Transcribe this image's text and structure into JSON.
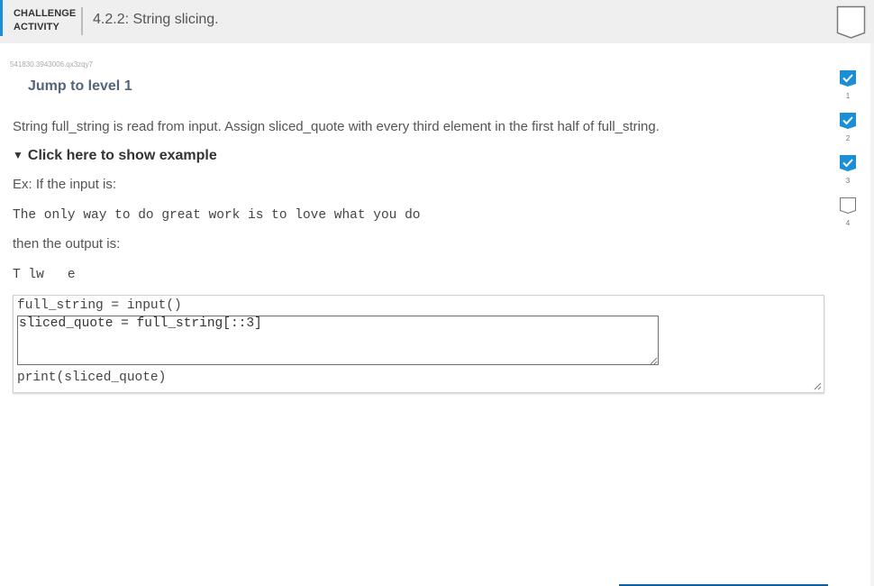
{
  "header": {
    "kind_line1": "CHALLENGE",
    "kind_line2": "ACTIVITY",
    "title": "4.2.2: String slicing.",
    "accent_color": "#1a8fd6"
  },
  "activity_id": "541830.3943006.qx3zqy7",
  "jump_link": "Jump to level 1",
  "prompt": "String full_string is read from input. Assign sliced_quote with every third element in the first half of full_string.",
  "example": {
    "toggle_label": "Click here to show example",
    "toggle_icon": "triangle-down",
    "input_label": "Ex: If the input is:",
    "input_text": "The only way to do great work is to love what you do",
    "output_label": "then the output is:",
    "output_text": "T lw   e"
  },
  "code": {
    "line1": "full_string = input()",
    "editable": "sliced_quote = full_string[::3]",
    "line_last": "print(sliced_quote)"
  },
  "levels": [
    {
      "label": "1",
      "completed": true
    },
    {
      "label": "2",
      "completed": true
    },
    {
      "label": "3",
      "completed": true
    },
    {
      "label": "4",
      "completed": false
    }
  ],
  "colors": {
    "level_complete": "#1a8fd6",
    "link": "#53657a"
  }
}
